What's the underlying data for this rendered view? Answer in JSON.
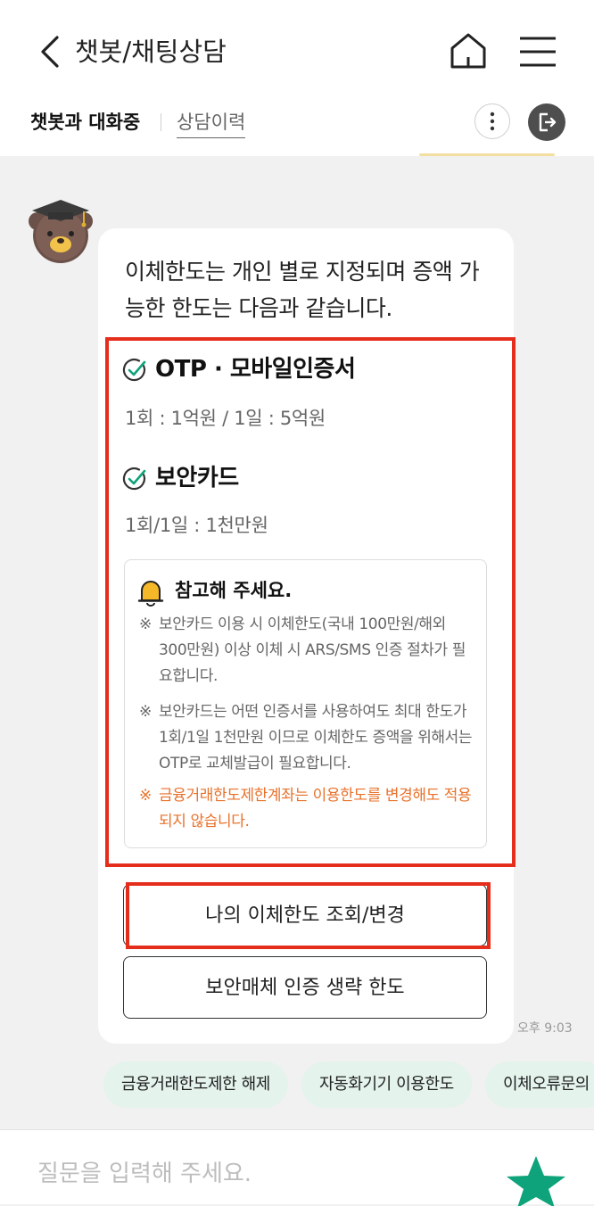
{
  "header": {
    "title": "챗봇/채팅상담",
    "tab_active": "챗봇과 대화중",
    "tab_history": "상담이력"
  },
  "message": {
    "intro": "이체한도는 개인 별로 지정되며 증액 가능한 한도는 다음과 같습니다.",
    "sections": [
      {
        "title": "OTP · 모바일인증서",
        "desc": "1회 : 1억원 / 1일 : 5억원"
      },
      {
        "title": "보안카드",
        "desc": "1회/1일 : 1천만원"
      }
    ],
    "notice": {
      "title": "참고해 주세요.",
      "mark": "※",
      "items": [
        "보안카드 이용 시 이체한도(국내 100만원/해외 300만원) 이상 이체 시 ARS/SMS 인증 절차가 필요합니다.",
        "보안카드는 어떤 인증서를 사용하여도 최대 한도가 1회/1일 1천만원 이므로 이체한도 증액을 위해서는 OTP로 교체발급이 필요합니다.",
        "금융거래한도제한계좌는 이용한도를 변경해도 적용되지 않습니다."
      ]
    },
    "buttons": [
      "나의 이체한도 조회/변경",
      "보안매체 인증 생략 한도"
    ],
    "time": "오후 9:03"
  },
  "chips": [
    "금융거래한도제한 해제",
    "자동화기기 이용한도",
    "이체오류문의"
  ],
  "input": {
    "placeholder": "질문을 입력해 주세요."
  },
  "colors": {
    "accent_green": "#0ea37a",
    "highlight_red": "#e52d1c",
    "warning_orange": "#e8712a",
    "chip_bg": "#e4f3ec"
  },
  "icons": [
    "back-arrow-icon",
    "home-icon",
    "menu-icon",
    "more-vertical-icon",
    "exit-icon",
    "bear-graduate-avatar-icon",
    "check-circle-icon",
    "bell-icon",
    "star-send-icon"
  ]
}
